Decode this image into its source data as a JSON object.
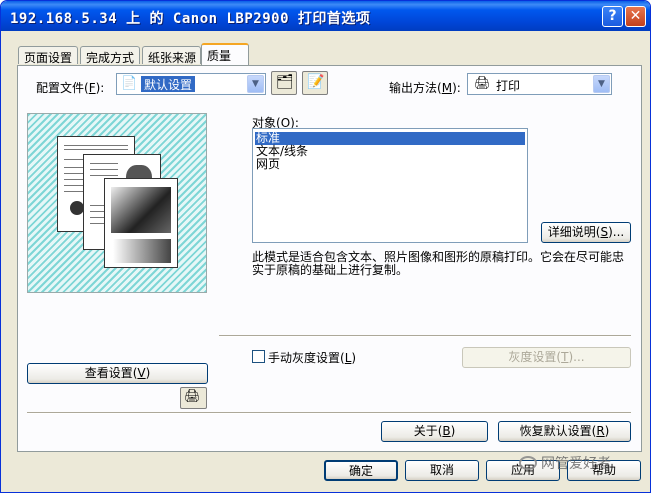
{
  "window": {
    "title": "192.168.5.34 上 的 Canon LBP2900 打印首选项"
  },
  "titlebar": {
    "help": "?",
    "close": "✕"
  },
  "tabs": [
    {
      "label": "页面设置"
    },
    {
      "label": "完成方式"
    },
    {
      "label": "纸张来源"
    },
    {
      "label": "质量"
    }
  ],
  "profile": {
    "label": "配置文件",
    "hotkey": "F",
    "value": "默认设置"
  },
  "output": {
    "label": "输出方法",
    "hotkey": "M",
    "value": "打印"
  },
  "object": {
    "label": "对象",
    "hotkey": "O",
    "items": [
      "标准",
      "文本/线条",
      "网页"
    ],
    "selected_index": 0
  },
  "details_button": {
    "label": "详细说明",
    "hotkey": "S"
  },
  "description": "此模式是适合包含文本、照片图像和图形的原稿打印。它会在尽可能忠实于原稿的基础上进行复制。",
  "grayscale": {
    "checkbox_label": "手动灰度设置",
    "hotkey": "L",
    "checked": false,
    "button_label": "灰度设置",
    "button_hotkey": "T"
  },
  "view_settings": {
    "label": "查看设置",
    "hotkey": "V"
  },
  "about_button": {
    "label": "关于",
    "hotkey": "B"
  },
  "restore_button": {
    "label": "恢复默认设置",
    "hotkey": "R"
  },
  "footer": {
    "ok": "确定",
    "cancel": "取消",
    "apply": "应用",
    "help": "帮助"
  },
  "watermark": "网管爱好者"
}
